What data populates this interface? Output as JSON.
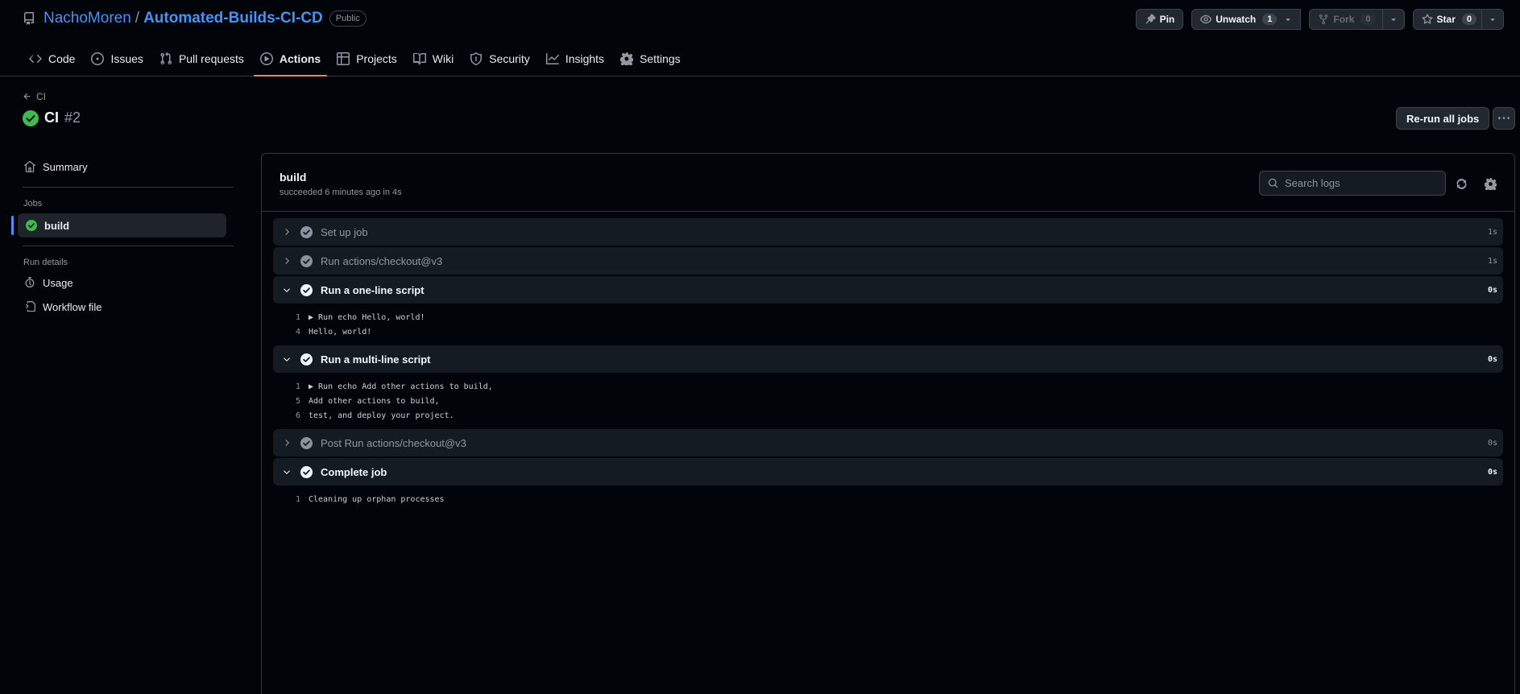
{
  "repo": {
    "owner": "NachoMoren",
    "separator": "/",
    "name": "Automated-Builds-CI-CD",
    "visibility": "Public",
    "icon": "repo-icon"
  },
  "repo_actions": {
    "pin": "Pin",
    "unwatch": "Unwatch",
    "watch_count": "1",
    "fork": "Fork",
    "fork_count": "0",
    "star": "Star",
    "star_count": "0"
  },
  "nav": {
    "items": [
      {
        "label": "Code",
        "icon": "code-icon"
      },
      {
        "label": "Issues",
        "icon": "issue-icon"
      },
      {
        "label": "Pull requests",
        "icon": "pull-request-icon"
      },
      {
        "label": "Actions",
        "icon": "play-icon",
        "active": true
      },
      {
        "label": "Projects",
        "icon": "table-icon"
      },
      {
        "label": "Wiki",
        "icon": "book-icon"
      },
      {
        "label": "Security",
        "icon": "shield-icon"
      },
      {
        "label": "Insights",
        "icon": "graph-icon"
      },
      {
        "label": "Settings",
        "icon": "gear-icon"
      }
    ]
  },
  "run": {
    "back_label": "CI",
    "title": "CI",
    "number": "#2",
    "rerun_label": "Re-run all jobs"
  },
  "sidebar": {
    "summary": "Summary",
    "jobs_heading": "Jobs",
    "job": "build",
    "run_details_heading": "Run details",
    "usage": "Usage",
    "workflow_file": "Workflow file"
  },
  "job": {
    "name": "build",
    "meta": "succeeded 6 minutes ago in 4s",
    "search_placeholder": "Search logs"
  },
  "steps": [
    {
      "name": "Set up job",
      "duration": "1s",
      "expanded": false,
      "lines": []
    },
    {
      "name": "Run actions/checkout@v3",
      "duration": "1s",
      "expanded": false,
      "lines": []
    },
    {
      "name": "Run a one-line script",
      "duration": "0s",
      "expanded": true,
      "lines": [
        {
          "n": "1",
          "t": "▶ Run echo Hello, world!"
        },
        {
          "n": "4",
          "t": "Hello, world!"
        }
      ]
    },
    {
      "name": "Run a multi-line script",
      "duration": "0s",
      "expanded": true,
      "lines": [
        {
          "n": "1",
          "t": "▶ Run echo Add other actions to build,"
        },
        {
          "n": "5",
          "t": "Add other actions to build,"
        },
        {
          "n": "6",
          "t": "test, and deploy your project."
        }
      ]
    },
    {
      "name": "Post Run actions/checkout@v3",
      "duration": "0s",
      "expanded": false,
      "lines": []
    },
    {
      "name": "Complete job",
      "duration": "0s",
      "expanded": true,
      "lines": [
        {
          "n": "1",
          "t": "Cleaning up orphan processes"
        }
      ]
    }
  ],
  "colors": {
    "background": "#010409",
    "link": "#4493f8",
    "success": "#3fb950",
    "active_tab_underline": "#f78166"
  }
}
